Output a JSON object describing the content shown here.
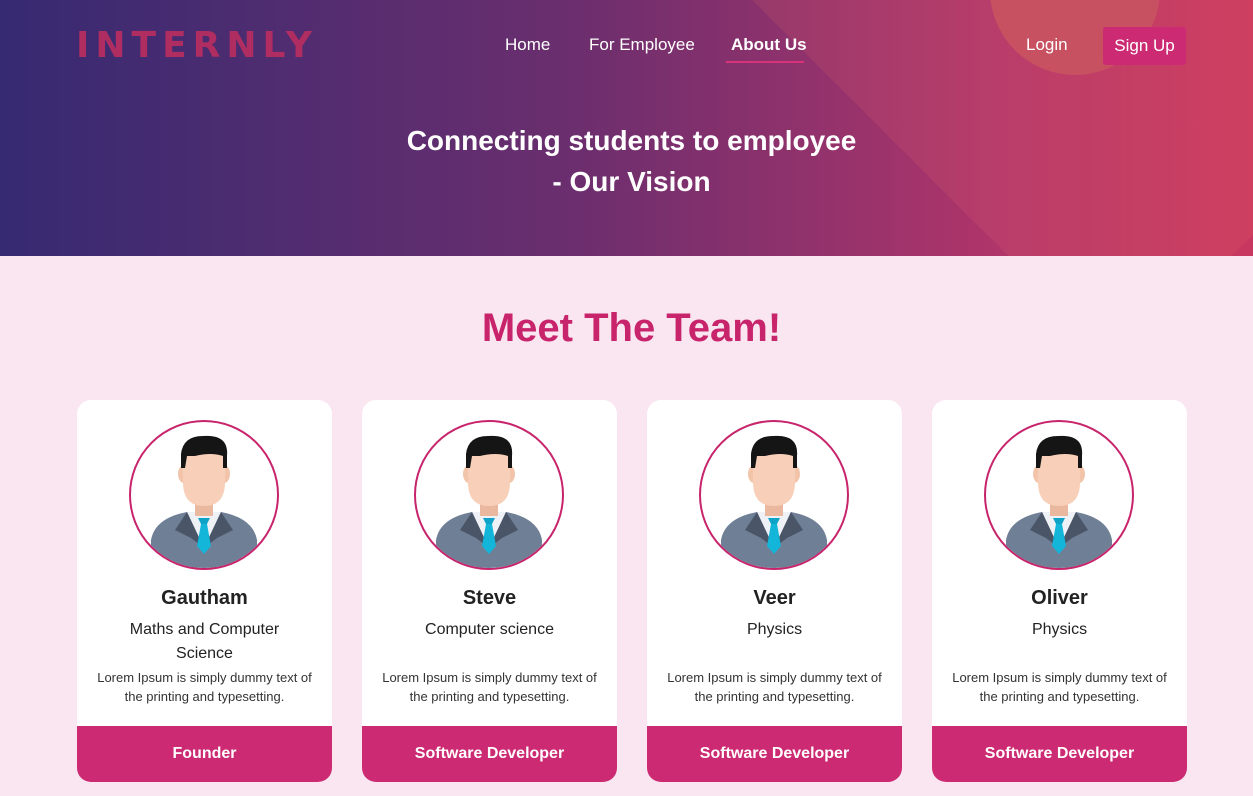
{
  "header": {
    "logo": "INTERNLY",
    "nav": {
      "home": "Home",
      "for_employee": "For Employee",
      "about_us": "About Us"
    },
    "login": "Login",
    "signup": "Sign Up"
  },
  "hero": {
    "line1": "Connecting students to employee",
    "line2": "- Our Vision"
  },
  "team": {
    "title": "Meet The Team!",
    "members": [
      {
        "name": "Gautham",
        "field": "Maths and Computer Science",
        "description": "Lorem Ipsum is simply dummy text of the printing and typesetting.",
        "role": "Founder"
      },
      {
        "name": "Steve",
        "field": "Computer science",
        "description": "Lorem Ipsum is simply dummy text of the printing and typesetting.",
        "role": "Software Developer"
      },
      {
        "name": "Veer",
        "field": "Physics",
        "description": "Lorem Ipsum is simply dummy text of the printing and typesetting.",
        "role": "Software Developer"
      },
      {
        "name": "Oliver",
        "field": "Physics",
        "description": "Lorem Ipsum is simply dummy text of the printing and typesetting.",
        "role": "Software Developer"
      }
    ]
  },
  "colors": {
    "accent": "#cc2a72",
    "title": "#c8246c",
    "page_background": "#f9e6f0",
    "hero_gradient_start": "#362a72",
    "hero_gradient_end": "#c8375f"
  },
  "icons": {
    "avatar": "businessman-avatar-icon"
  }
}
